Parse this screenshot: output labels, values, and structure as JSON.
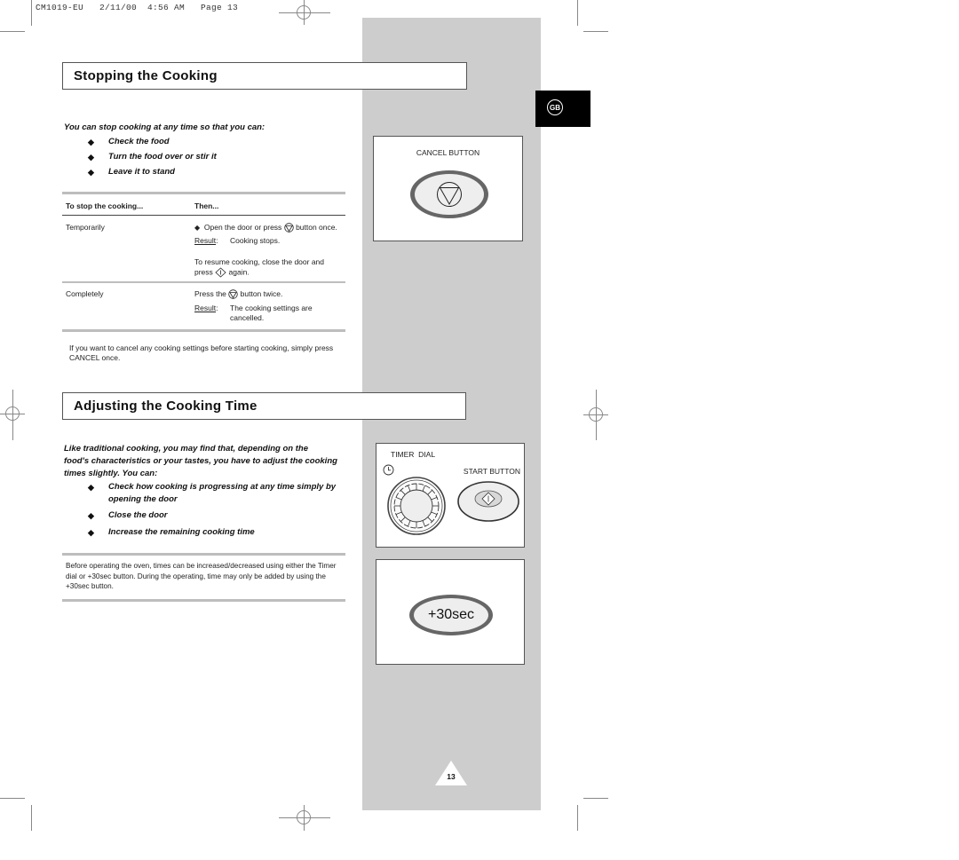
{
  "slug": "CM1019-EU   2/11/00  4:56 AM   Page 13",
  "language_tab": "GB",
  "page_number": "13",
  "colors": {
    "side_column": "#cdcdcd",
    "tab_bg": "#000000",
    "rule": "#bdbdbd"
  },
  "stopping": {
    "title": "Stopping the Cooking",
    "lead": "You can stop cooking at any time so that you can:",
    "bullets": [
      "Check the food",
      "Turn the food over or stir it",
      "Leave it to stand"
    ],
    "table": {
      "col1_header": "To stop the cooking...",
      "col2_header": "Then...",
      "rows": [
        {
          "condition": "Temporarily",
          "action_pre": "Open the door or press",
          "action_post": "button once.",
          "result_label": "Result",
          "result_text": "Cooking stops.",
          "resume_line1": "To resume cooking, close the door and",
          "resume_pre": "press",
          "resume_post": "again."
        },
        {
          "condition": "Completely",
          "action_pre": "Press the",
          "action_post": "button twice.",
          "result_label": "Result",
          "result_line1": "The cooking settings are",
          "result_line2": "cancelled."
        }
      ]
    },
    "note_line1": "If you want to cancel any cooking settings before starting cooking, simply press",
    "note_line2": "CANCEL once.",
    "figure_label": "CANCEL BUTTON"
  },
  "adjusting": {
    "title": "Adjusting the Cooking Time",
    "lead_lines": [
      "Like traditional cooking, you may find that, depending on the",
      "food's characteristics or your tastes, you have to adjust the cooking",
      "times slightly. You can:"
    ],
    "bullets": [
      [
        "Check how cooking is progressing at any time simply by",
        "opening the door"
      ],
      [
        "Close the door"
      ],
      [
        "Increase the remaining cooking time"
      ]
    ],
    "note_lines": [
      "Before operating the oven, times can be increased/decreased using either the Timer",
      "dial or +30sec button. During the operating, time may only be added by using the",
      "+30sec button."
    ],
    "timer_label": "TIMER  DIAL",
    "start_label": "START BUTTON",
    "plus30_label": "+30sec"
  },
  "icons": [
    "cancel-stop-icon",
    "start-diamond-icon",
    "clock-icon",
    "timer-dial-icon",
    "registration-mark-icon",
    "page-triangle-icon"
  ]
}
